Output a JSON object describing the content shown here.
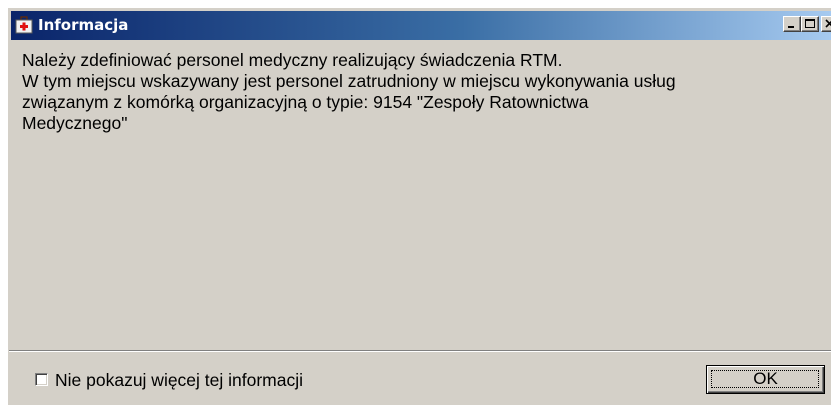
{
  "window": {
    "title": "Informacja",
    "title_icon": "first-aid-kit-icon",
    "controls": {
      "minimize": "minimize-icon",
      "maximize": "maximize-icon",
      "close": "close-icon"
    }
  },
  "message": {
    "lines": [
      "Należy zdefiniować personel medyczny realizujący świadczenia RTM.",
      "W tym miejscu wskazywany jest personel zatrudniony w miejscu wykonywania usług",
      "związanym z komórką organizacyjną o typie: 9154 \"Zespoły Ratownictwa",
      "Medycznego\""
    ]
  },
  "footer": {
    "checkbox_label": "Nie pokazuj więcej tej informacji",
    "checkbox_checked": false,
    "ok_label": "OK"
  },
  "colors": {
    "title_gradient_start": "#0a246a",
    "title_gradient_end": "#a6caf0",
    "dialog_background": "#d4d0c8"
  }
}
